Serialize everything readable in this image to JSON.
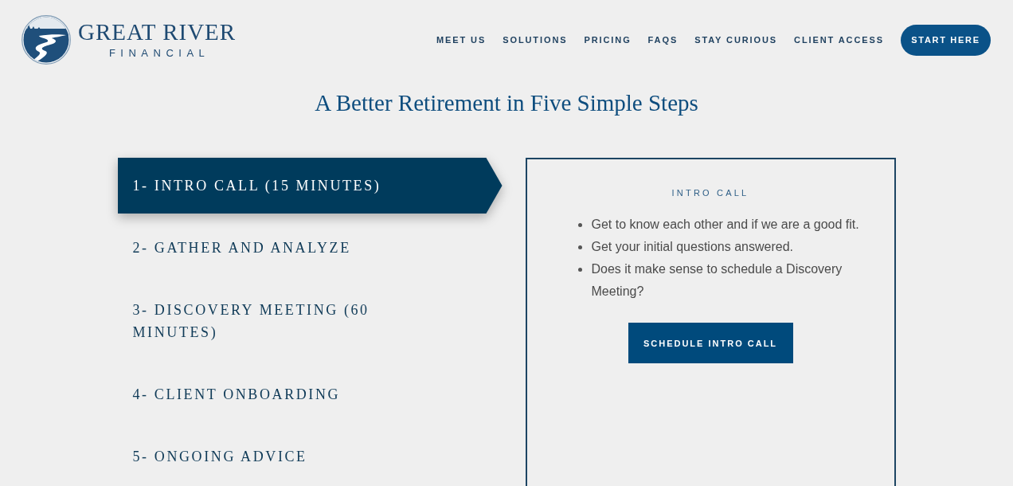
{
  "header": {
    "logo": {
      "name": "GREAT RIVER",
      "tagline": "FINANCIAL"
    },
    "nav": [
      "MEET US",
      "SOLUTIONS",
      "PRICING",
      "FAQS",
      "STAY CURIOUS",
      "CLIENT ACCESS"
    ],
    "cta": "START HERE"
  },
  "heading": "A Better Retirement in Five Simple Steps",
  "steps": [
    {
      "label": "1- INTRO CALL (15 MINUTES)",
      "selected": true
    },
    {
      "label": "2- GATHER AND ANALYZE",
      "selected": false
    },
    {
      "label": "3- DISCOVERY MEETING (60 MINUTES)",
      "selected": false
    },
    {
      "label": "4- CLIENT ONBOARDING",
      "selected": false
    },
    {
      "label": "5- ONGOING ADVICE",
      "selected": false
    }
  ],
  "panel": {
    "title": "INTRO CALL",
    "bullets": [
      "Get to know each other and if we are a good fit.",
      "Get your initial questions answered.",
      "Does it make sense to schedule a Discovery Meeting?"
    ],
    "button": "SCHEDULE INTRO CALL"
  }
}
